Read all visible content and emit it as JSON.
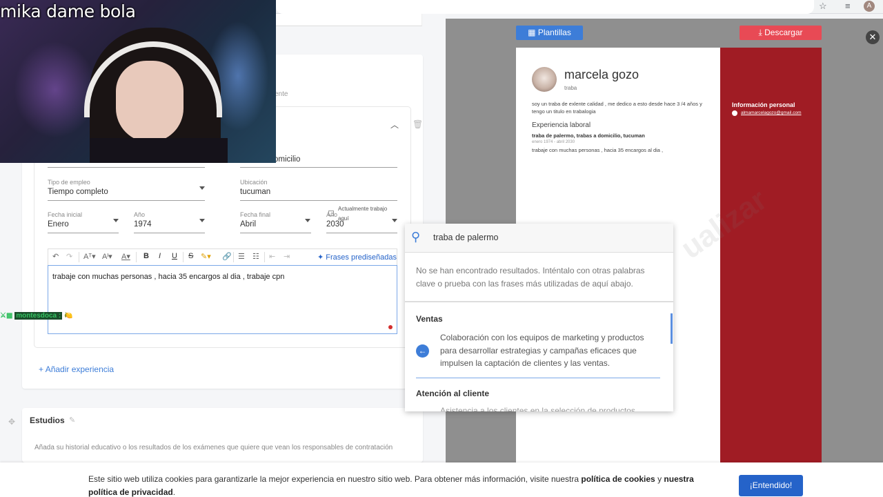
{
  "stream": {
    "title": "mika dame bola"
  },
  "browser": {
    "avatar_letter": "A"
  },
  "editor": {
    "section_hint_fragment": "ente",
    "fragment_domicilio": "omicilio",
    "job_type": {
      "label": "Tipo de empleo",
      "value": "Tiempo completo"
    },
    "location": {
      "label": "Ubicación",
      "value": "tucuman"
    },
    "start_date": {
      "label": "Fecha inicial",
      "month": "Enero",
      "year_label": "Año",
      "year": "1974"
    },
    "end_date": {
      "label": "Fecha final",
      "month": "Abril",
      "year_label": "Año",
      "year": "2030",
      "current_job_label": "Actualmente trabajo aquí"
    },
    "toolbar": {
      "frases_label": "Frases prediseñadas"
    },
    "description_text": "trabaje con muchas personas , hacia 35 encargos al dia , trabaje cpn",
    "add_experience": "Añadir experiencia",
    "estudios": {
      "title": "Estudios",
      "description": "Añada su historial educativo o los resultados de los exámenes que quiere que vean los responsables de contratación"
    }
  },
  "chat": {
    "user": "montesdoca :",
    "emoji": "🍋"
  },
  "preview": {
    "templates_button": "Plantillas",
    "download_button": "Descargar",
    "close_label": "✕",
    "resume": {
      "name": "marcela gozo",
      "role": "traba",
      "summary": "soy un traba de exlente calidad , me dedico a esto desde hace 3 /4 años y tengo un titulo en trabalogia",
      "experience_heading": "Experiencia laboral",
      "job_title": "traba de palermo, trabas a domicilio, tucuman",
      "job_dates": "enero 1974 - abril 2030",
      "job_desc": "trabaje con muchas personas , hacia 35 encargos al dia ,",
      "side_heading": "Información personal",
      "email": "almamarcelagozo@gmail.com"
    },
    "watermark": "ualizar"
  },
  "suggestions": {
    "query": "traba de palermo",
    "no_results": "No se han encontrado resultados. Inténtalo con otras palabras clave o prueba con las frases más utilizadas de aquí abajo.",
    "categories": [
      {
        "name": "Ventas",
        "phrase": "Colaboración con los equipos de marketing y productos para desarrollar estrategias y campañas eficaces que impulsen la captación de clientes y las ventas."
      },
      {
        "name": "Atención al cliente",
        "phrase": "Asistencia a los clientes en la selección de productos"
      }
    ]
  },
  "cookie": {
    "text_start": "Este sitio web utiliza cookies para garantizarle la mejor experiencia en nuestro sitio web. Para obtener más información, visite nuestra ",
    "link_cookies": "política de cookies",
    "text_mid": " y ",
    "link_privacy": "nuestra política de privacidad",
    "text_end": ".",
    "accept_button": "¡Entendido!"
  },
  "colors": {
    "accent": "#3d7dd8",
    "download": "#e84a55",
    "resume_side": "#a01c24"
  }
}
